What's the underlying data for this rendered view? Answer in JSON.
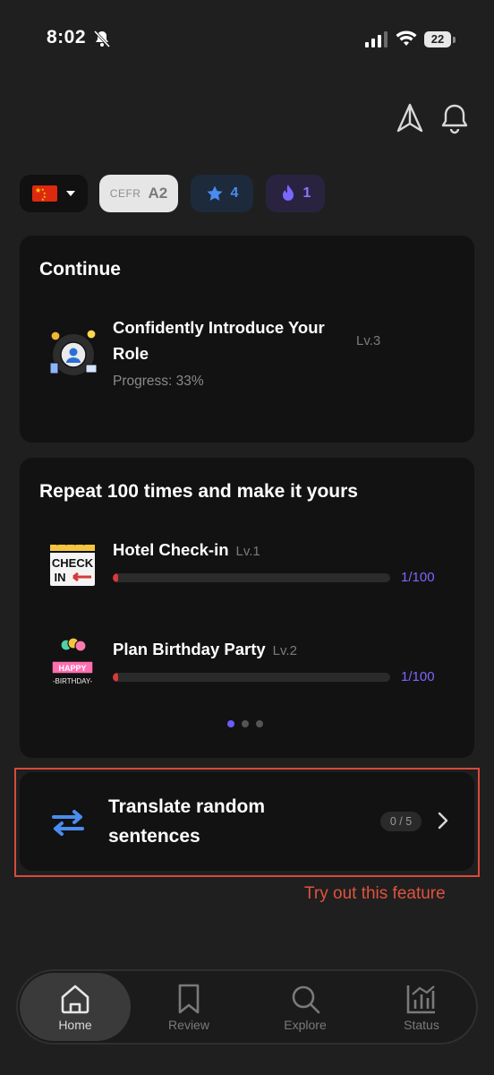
{
  "status_bar": {
    "time": "8:02",
    "battery": "22"
  },
  "chips": {
    "cefr_tag": "CEFR",
    "cefr_level": "A2",
    "stars": "4",
    "streak": "1"
  },
  "continue": {
    "title": "Continue",
    "lesson_title": "Confidently Introduce Your Role",
    "level": "Lv.3",
    "progress": "Progress: 33%",
    "progress_value": 0.33
  },
  "repeat": {
    "title": "Repeat 100 times and make it yours",
    "items": [
      {
        "title": "Hotel Check-in",
        "level": "Lv.1",
        "count": "1/100",
        "progress": 0.01
      },
      {
        "title": "Plan Birthday Party",
        "level": "Lv.2",
        "count": "1/100",
        "progress": 0.01
      }
    ],
    "page_count": 3,
    "active_page": 0
  },
  "translate": {
    "title": "Translate random sentences",
    "count": "0 / 5"
  },
  "hint": "Try out this feature",
  "tabs": [
    {
      "label": "Home",
      "icon": "home-icon",
      "active": true
    },
    {
      "label": "Review",
      "icon": "bookmark-icon",
      "active": false
    },
    {
      "label": "Explore",
      "icon": "search-icon",
      "active": false
    },
    {
      "label": "Status",
      "icon": "chart-icon",
      "active": false
    }
  ],
  "colors": {
    "accent": "#6a5cff",
    "star_blue": "#4a8cf0",
    "highlight": "#d84a3a",
    "progress_red": "#d63a3a"
  }
}
